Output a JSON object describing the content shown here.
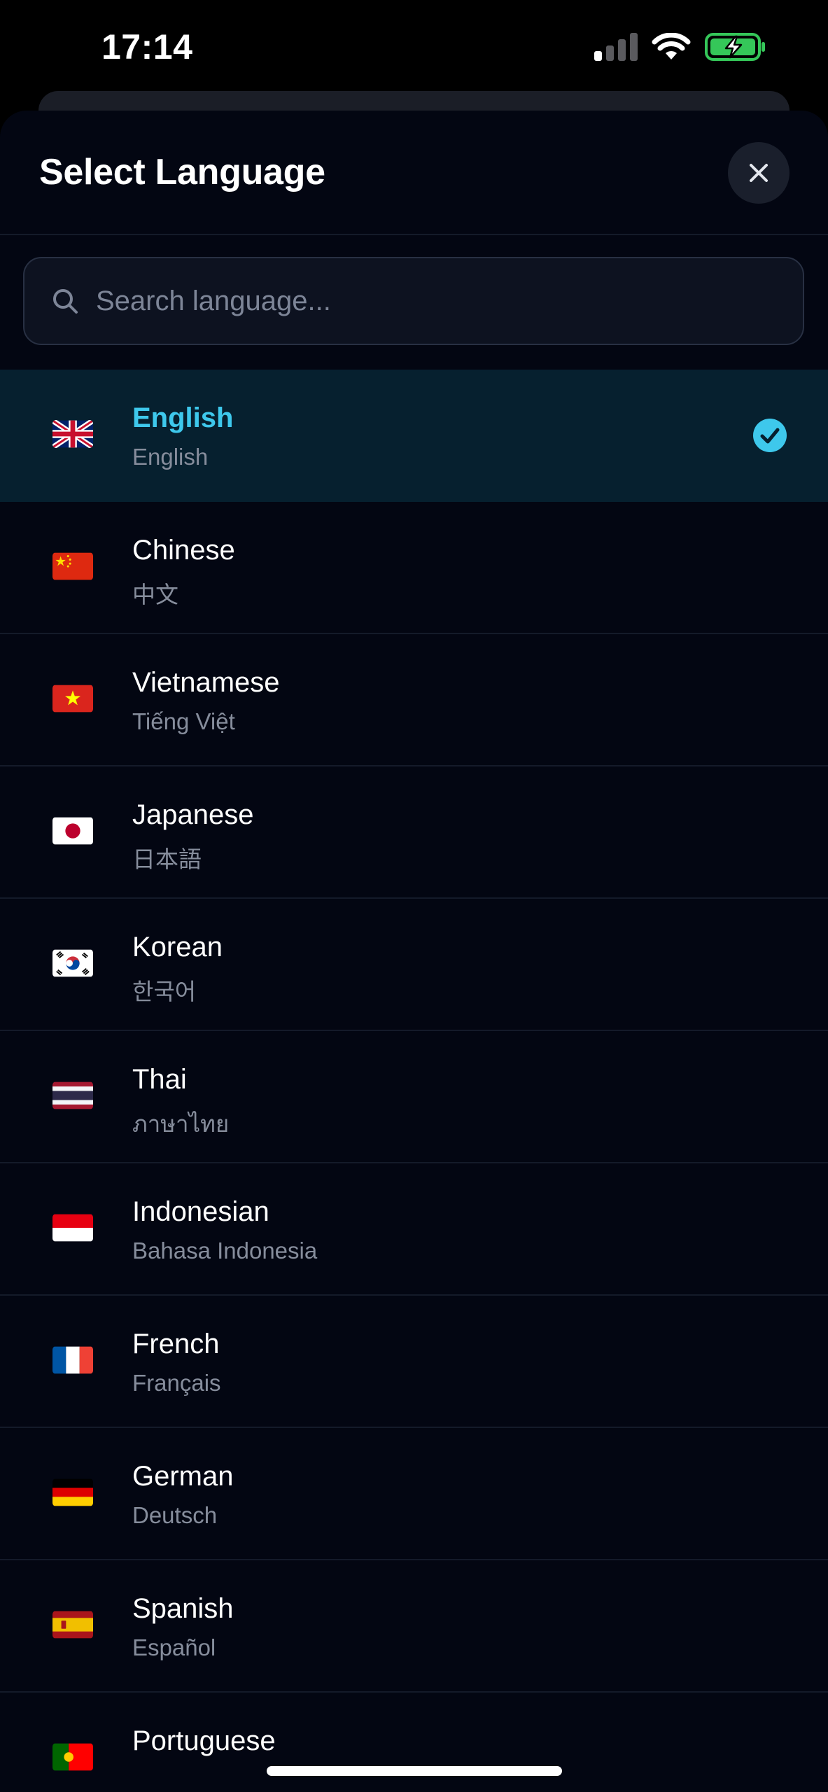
{
  "status_bar": {
    "time": "17:14"
  },
  "sheet": {
    "title": "Select Language",
    "close_icon": "close-icon"
  },
  "search": {
    "placeholder": "Search language...",
    "value": "",
    "icon": "search-icon"
  },
  "languages": [
    {
      "name": "English",
      "native": "English",
      "flag": "uk",
      "selected": true
    },
    {
      "name": "Chinese",
      "native": "中文",
      "flag": "cn",
      "selected": false
    },
    {
      "name": "Vietnamese",
      "native": "Tiếng Việt",
      "flag": "vn",
      "selected": false
    },
    {
      "name": "Japanese",
      "native": "日本語",
      "flag": "jp",
      "selected": false
    },
    {
      "name": "Korean",
      "native": "한국어",
      "flag": "kr",
      "selected": false
    },
    {
      "name": "Thai",
      "native": "ภาษาไทย",
      "flag": "th",
      "selected": false
    },
    {
      "name": "Indonesian",
      "native": "Bahasa Indonesia",
      "flag": "id",
      "selected": false
    },
    {
      "name": "French",
      "native": "Français",
      "flag": "fr",
      "selected": false
    },
    {
      "name": "German",
      "native": "Deutsch",
      "flag": "de",
      "selected": false
    },
    {
      "name": "Spanish",
      "native": "Español",
      "flag": "es",
      "selected": false
    },
    {
      "name": "Portuguese",
      "native": "",
      "flag": "pt",
      "selected": false
    }
  ],
  "colors": {
    "accent": "#3ec8ec",
    "background": "#030612",
    "selected_row": "#06202f",
    "battery": "#35c759"
  }
}
